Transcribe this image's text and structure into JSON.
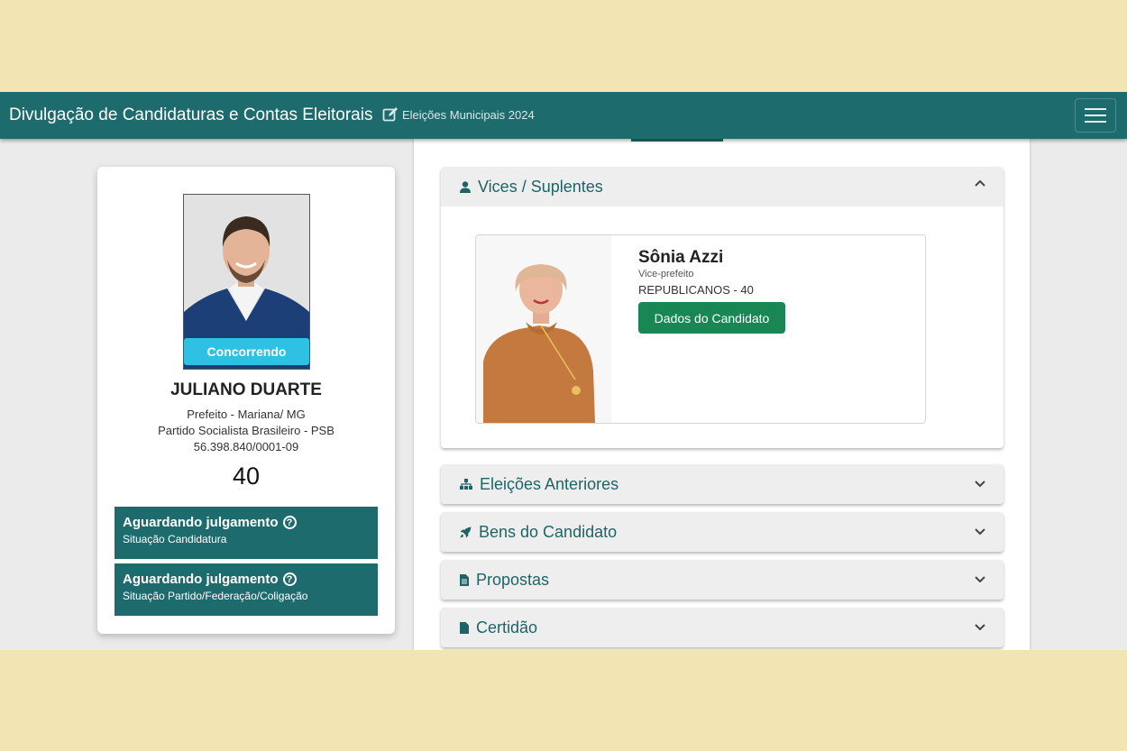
{
  "header": {
    "title": "Divulgação de Candidaturas e Contas Eleitorais",
    "subtitle": "Eleições Municipais 2024"
  },
  "candidate": {
    "name": "JULIANO DUARTE",
    "status_badge": "Concorrendo",
    "office_location": "Prefeito - Mariana/ MG",
    "party": "Partido Socialista Brasileiro - PSB",
    "cnpj": "56.398.840/0001-09",
    "number": "40",
    "situations": [
      {
        "title": "Aguardando julgamento",
        "subtitle": "Situação Candidatura"
      },
      {
        "title": "Aguardando julgamento",
        "subtitle": "Situação Partido/Federação/Coligação"
      }
    ]
  },
  "sections": {
    "vices": "Vices / Suplentes",
    "previous_elections": "Eleições Anteriores",
    "assets": "Bens do Candidato",
    "proposals": "Propostas",
    "certificate": "Certidão"
  },
  "vice": {
    "name": "Sônia Azzi",
    "role": "Vice-prefeito",
    "party": "REPUBLICANOS - 40",
    "button_label": "Dados do Candidato"
  },
  "colors": {
    "primary": "#1e6b6e",
    "status_badge": "#2ec1e4",
    "button_green": "#198754",
    "backdrop": "#f2e5b3"
  }
}
